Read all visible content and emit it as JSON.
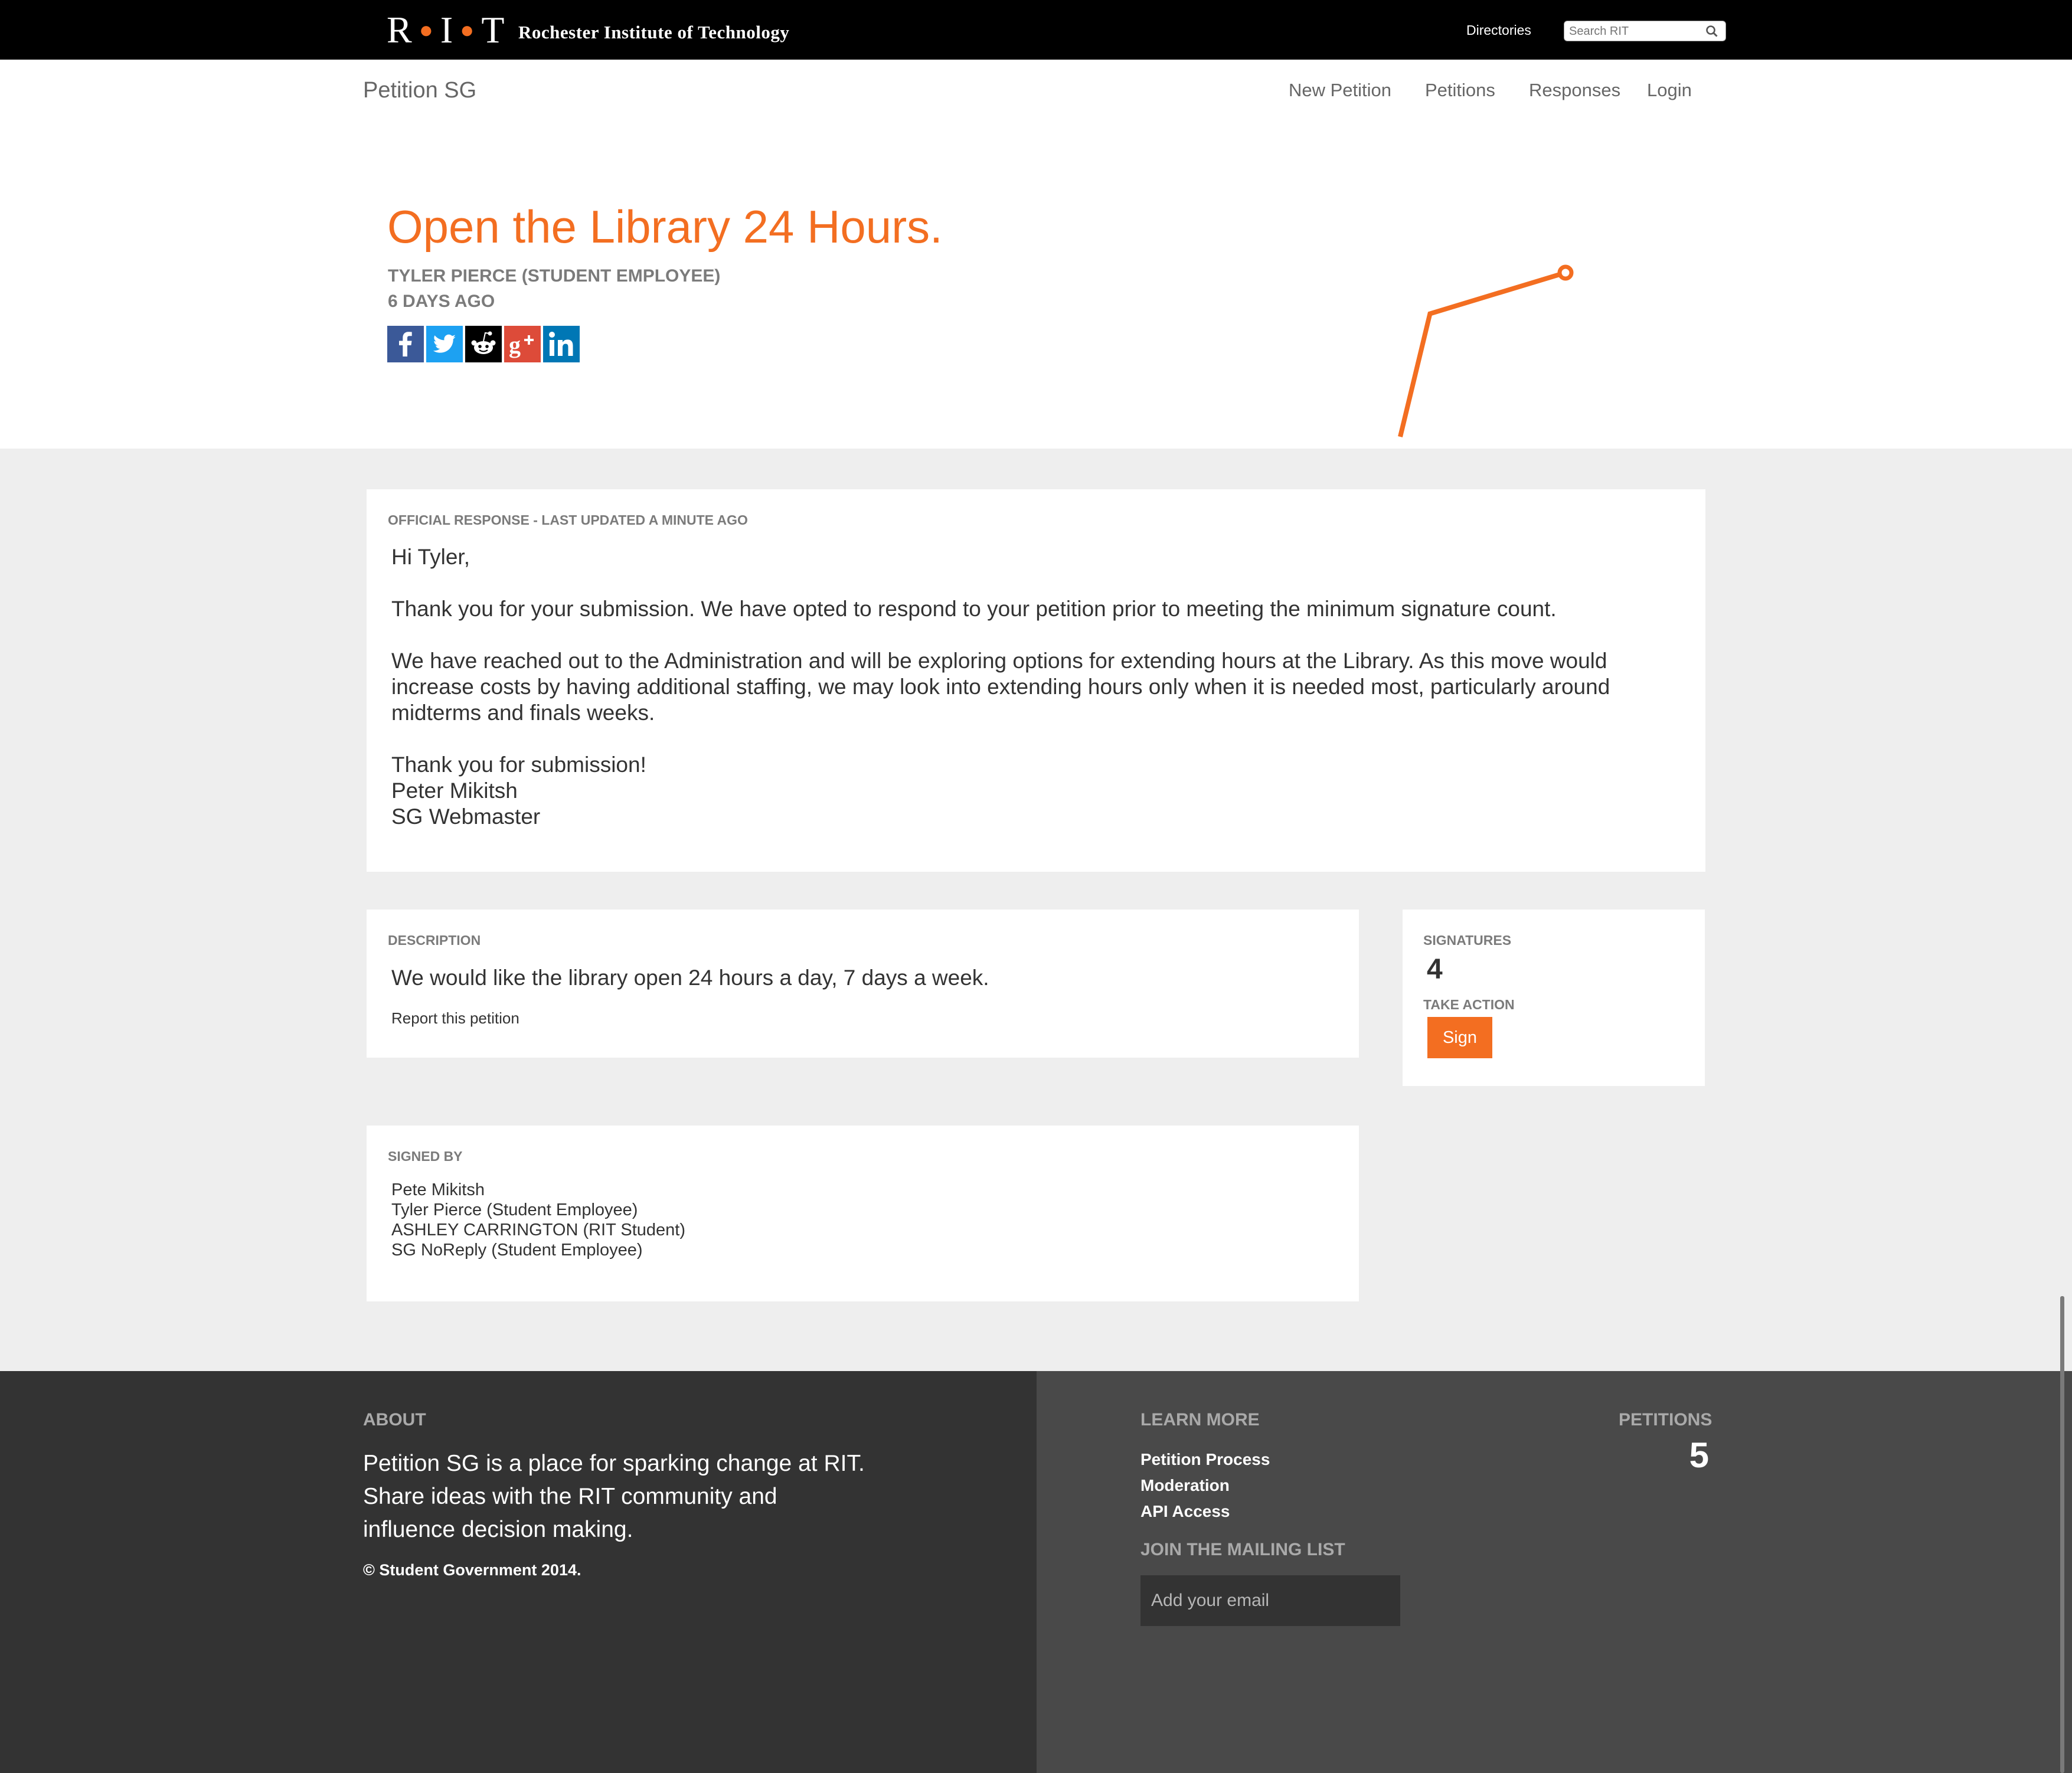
{
  "topbar": {
    "logo_text": "R·I·T",
    "logo_letters": [
      "R",
      "I",
      "T"
    ],
    "institution_name": "Rochester Institute of Technology",
    "directories_label": "Directories",
    "search_placeholder": "Search RIT"
  },
  "site": {
    "brand": "Petition SG",
    "nav": [
      {
        "label": "New Petition"
      },
      {
        "label": "Petitions"
      },
      {
        "label": "Responses"
      },
      {
        "label": "Login"
      }
    ]
  },
  "petition": {
    "title": "Open the Library 24 Hours.",
    "author": "TYLER PIERCE (STUDENT EMPLOYEE)",
    "age": "6 DAYS AGO",
    "share_icons": [
      "facebook-icon",
      "twitter-icon",
      "reddit-icon",
      "google-plus-icon",
      "linkedin-icon"
    ],
    "signature_trend": [
      0,
      3,
      4
    ]
  },
  "response": {
    "label": "OFFICIAL RESPONSE - LAST UPDATED A MINUTE AGO",
    "lines": [
      "Hi Tyler,",
      "Thank you for your submission. We have opted to respond to your petition prior to meeting the minimum signature count.",
      "We have reached out to the Administration and will be exploring options for extending hours at the Library. As this move would",
      "increase costs by having additional staffing, we may look into extending hours only when it is needed most, particularly around",
      "midterms and finals weeks.",
      "Thank you for submission!",
      "Peter Mikitsh",
      "SG Webmaster"
    ]
  },
  "description": {
    "label": "DESCRIPTION",
    "text": "We would like the library open 24 hours a day, 7 days a week.",
    "report_link": "Report this petition"
  },
  "signatures": {
    "label": "SIGNATURES",
    "count": "4",
    "action_label": "TAKE ACTION",
    "sign_button": "Sign"
  },
  "signed_by": {
    "label": "SIGNED BY",
    "names": [
      "Pete Mikitsh",
      "Tyler Pierce (Student Employee)",
      "ASHLEY CARRINGTON (RIT Student)",
      "SG NoReply (Student Employee)"
    ]
  },
  "footer": {
    "about_heading": "ABOUT",
    "about_lines": [
      "Petition SG is a place for sparking change at RIT.",
      "Share ideas with the RIT community and",
      "influence decision making."
    ],
    "copyright": "© Student Government 2014.",
    "learn_more_heading": "LEARN MORE",
    "links": [
      "Petition Process",
      "Moderation",
      "API Access"
    ],
    "mailing_heading": "JOIN THE MAILING LIST",
    "email_placeholder": "Add your email",
    "petitions_heading": "PETITIONS",
    "petitions_count": "5"
  },
  "colors": {
    "accent": "#f36e21",
    "topbar": "#000000",
    "content_bg": "#eeeeee",
    "footer_left": "#333333",
    "footer_right": "#494949"
  }
}
